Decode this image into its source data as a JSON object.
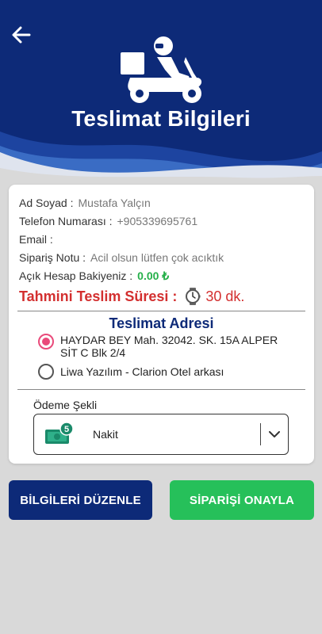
{
  "header": {
    "title": "Teslimat Bilgileri",
    "back_icon": "arrow-left-icon",
    "illustration_icon": "delivery-courier-icon",
    "colors": {
      "primary": "#0d2a78",
      "wave": "#2d59b3"
    }
  },
  "info": {
    "name_label": "Ad Soyad :",
    "name_value": "Mustafa Yalçın",
    "phone_label": "Telefon Numarası :",
    "phone_value": "+905339695761",
    "email_label": "Email :",
    "email_value": "",
    "note_label": "Sipariş Notu :",
    "note_value": "Acil olsun lütfen çok acıktık",
    "balance_label": "Açık Hesap Bakiyeniz :",
    "balance_value": "0.00 ₺",
    "balance_color": "#26b04a"
  },
  "eta": {
    "label": "Tahmini Teslim Süresi :",
    "value": "30 dk.",
    "icon": "wristwatch-icon",
    "color": "#d32f2f"
  },
  "address": {
    "title": "Teslimat Adresi",
    "options": [
      {
        "label": "HAYDAR BEY Mah. 32042. SK. 15A  ALPER SİT C Blk 2/4",
        "selected": true
      },
      {
        "label": "Liwa Yazılım - Clarion Otel arkası",
        "selected": false
      }
    ]
  },
  "payment": {
    "label": "Ödeme Şekli",
    "selected": "Nakit",
    "icon": "cash-icon",
    "badge": "5"
  },
  "actions": {
    "edit_label": "BİLGİLERİ DÜZENLE",
    "confirm_label": "SİPARİŞİ ONAYLA",
    "edit_color": "#0d2a78",
    "confirm_color": "#26c05a"
  }
}
